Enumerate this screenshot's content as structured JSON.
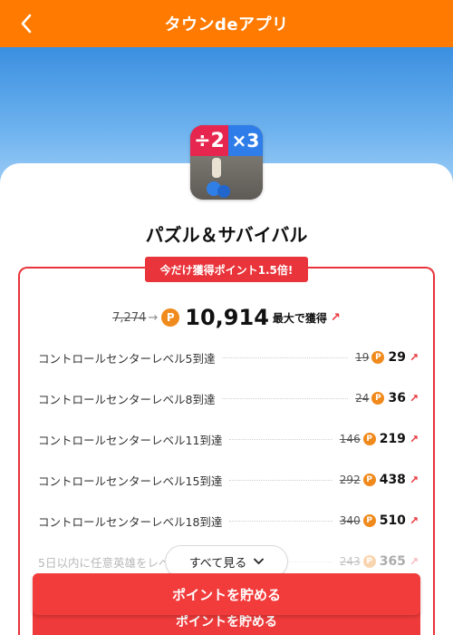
{
  "header": {
    "title": "タウンdeアプリ",
    "back_icon": "chevron-left-icon"
  },
  "app": {
    "name": "パズル＆サバイバル",
    "icon_text_left": "÷2",
    "icon_text_right": "×3"
  },
  "campaign": {
    "label": "今だけ獲得ポイント1.5倍!"
  },
  "total": {
    "old_points": "7,274",
    "arrow": "→",
    "points_icon": "P",
    "new_points": "10,914",
    "suffix": "最大で獲得",
    "link_icon": "↗"
  },
  "missions": [
    {
      "label": "コントロールセンターレベル5到達",
      "old": "19",
      "points": "29"
    },
    {
      "label": "コントロールセンターレベル8到達",
      "old": "24",
      "points": "36"
    },
    {
      "label": "コントロールセンターレベル11到達",
      "old": "146",
      "points": "219"
    },
    {
      "label": "コントロールセンターレベル15到達",
      "old": "292",
      "points": "438"
    },
    {
      "label": "コントロールセンターレベル18到達",
      "old": "340",
      "points": "510"
    },
    {
      "label": "5日以内に任意英雄をレベ",
      "old": "243",
      "points": "365"
    }
  ],
  "see_all": {
    "label": "すべて見る",
    "icon": "chevron-down-icon"
  },
  "cta": {
    "label": "ポイントを貯める",
    "shadow_label": "ポイントを貯める"
  },
  "colors": {
    "header": "#ff7a00",
    "accent_red": "#e8343a",
    "points_orange": "#f08a1c"
  }
}
